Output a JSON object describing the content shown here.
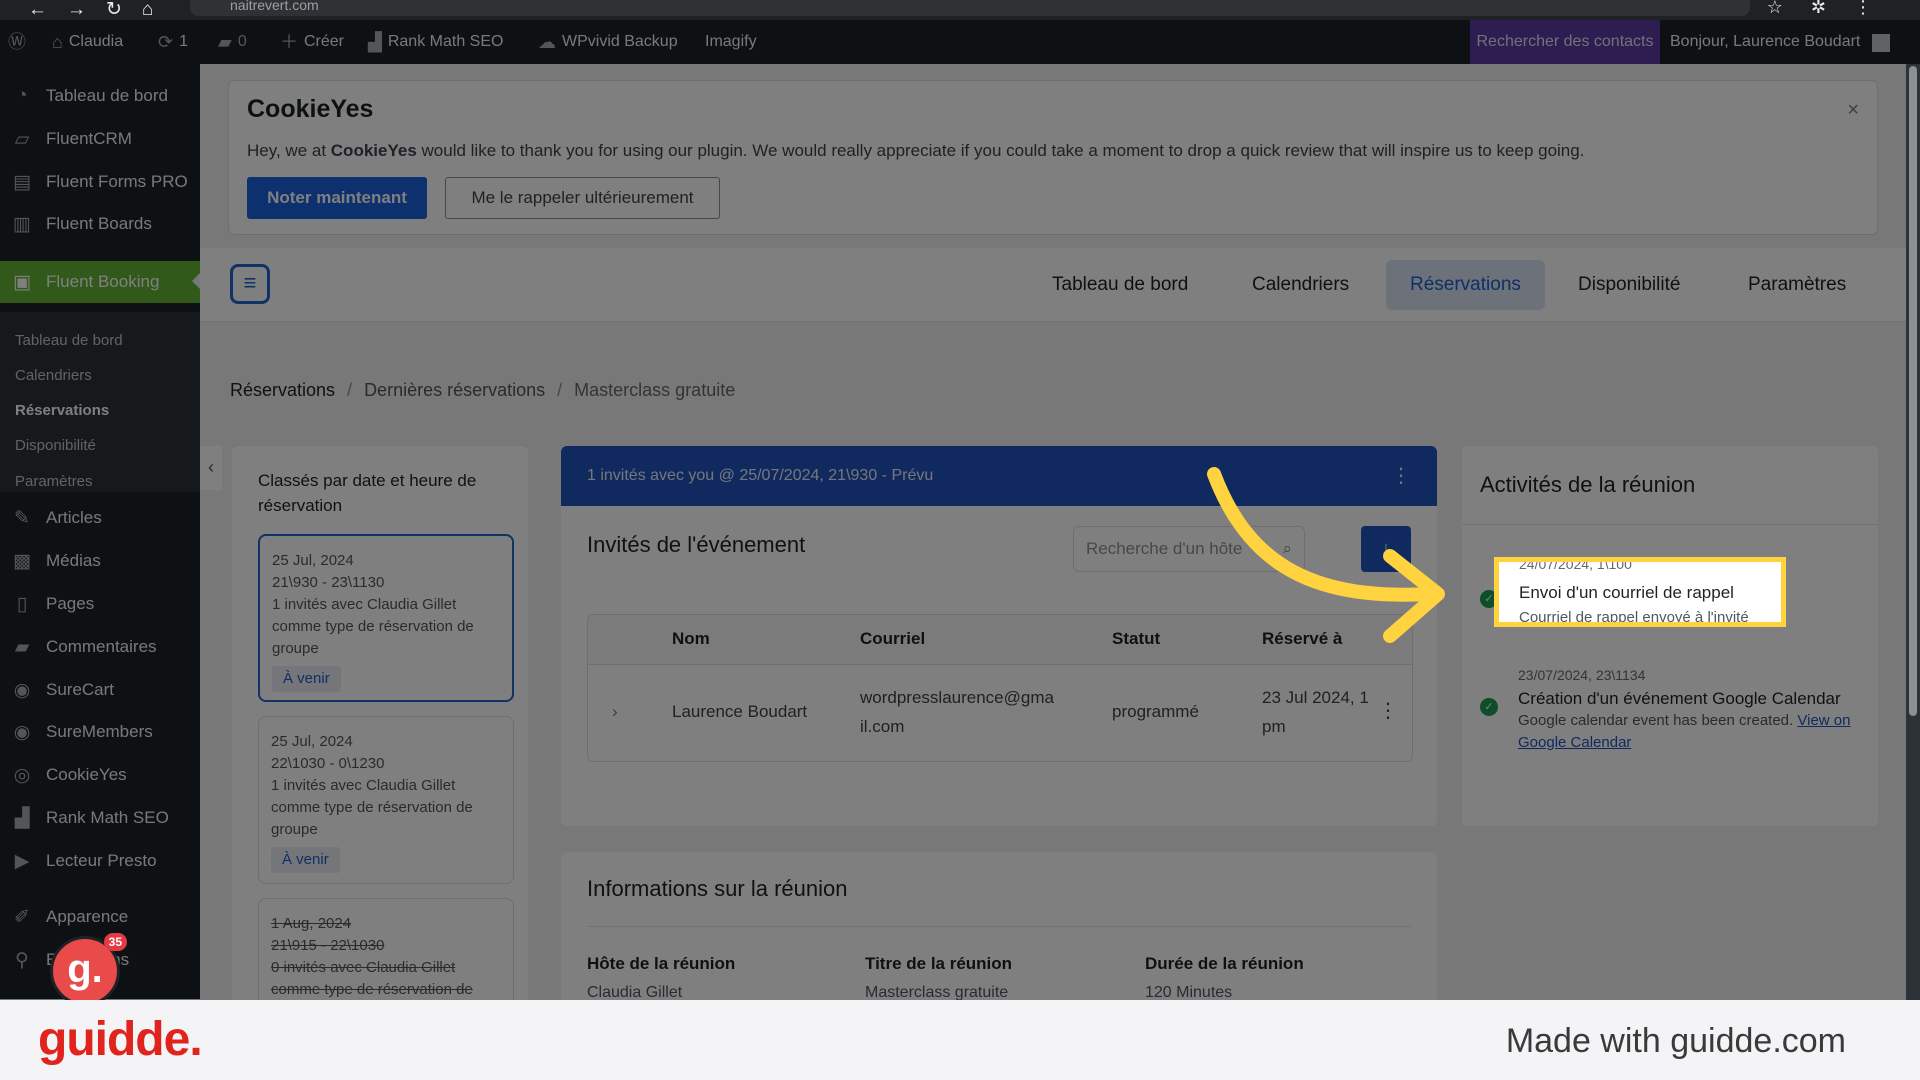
{
  "browser": {
    "url": "naitrevert.com"
  },
  "adminbar": {
    "site": "Claudia",
    "updates": "1",
    "comments": "0",
    "create": "Créer",
    "rankmath": "Rank Math SEO",
    "wpvivid": "WPvivid Backup",
    "imagify": "Imagify",
    "search": "Rechercher des contacts",
    "greeting": "Bonjour, Laurence Boudart"
  },
  "sidebar": {
    "items": [
      {
        "label": "Tableau de bord",
        "icon": "dashboard-icon"
      },
      {
        "label": "FluentCRM",
        "icon": "fluentcrm-icon"
      },
      {
        "label": "Fluent Forms PRO",
        "icon": "forms-icon"
      },
      {
        "label": "Fluent Boards",
        "icon": "boards-icon"
      },
      {
        "label": "Fluent Booking",
        "icon": "booking-icon"
      },
      {
        "label": "Articles",
        "icon": "pin-icon"
      },
      {
        "label": "Médias",
        "icon": "media-icon"
      },
      {
        "label": "Pages",
        "icon": "pages-icon"
      },
      {
        "label": "Commentaires",
        "icon": "comment-icon"
      },
      {
        "label": "SureCart",
        "icon": "surecart-icon"
      },
      {
        "label": "SureMembers",
        "icon": "suremembers-icon"
      },
      {
        "label": "CookieYes",
        "icon": "cookieyes-icon"
      },
      {
        "label": "Rank Math SEO",
        "icon": "rankmath-icon"
      },
      {
        "label": "Lecteur Presto",
        "icon": "presto-icon"
      },
      {
        "label": "Apparence",
        "icon": "appearance-icon"
      },
      {
        "label": "Extensions",
        "icon": "plugins-icon"
      }
    ],
    "submenu": [
      "Tableau de bord",
      "Calendriers",
      "Réservations",
      "Disponibilité",
      "Paramètres"
    ]
  },
  "cookie": {
    "logo": "CookieYes",
    "message_pre": "Hey, we at ",
    "message_brand": "CookieYes",
    "message_post": " would like to thank you for using our plugin. We would really appreciate if you could take a moment to drop a quick review that will inspire us to keep going.",
    "rate_button": "Noter maintenant",
    "remind_button": "Me le rappeler ultérieurement"
  },
  "appnav": {
    "tabs": [
      "Tableau de bord",
      "Calendriers",
      "Réservations",
      "Disponibilité",
      "Paramètres"
    ],
    "selected": "Réservations"
  },
  "breadcrumb": [
    "Réservations",
    "Dernières réservations",
    "Masterclass gratuite"
  ],
  "left": {
    "header": "Classés par date et heure de réservation",
    "bookings": [
      {
        "date": "25 Jul, 2024",
        "time": "21\\930 - 23\\1130",
        "desc": "1 invités avec Claudia Gillet comme type de réservation de groupe",
        "badge": "À venir"
      },
      {
        "date": "25 Jul, 2024",
        "time": "22\\1030 - 0\\1230",
        "desc": "1 invités avec Claudia Gillet comme type de réservation de groupe",
        "badge": "À venir"
      },
      {
        "date": "1 Aug, 2024",
        "time": "21\\915 - 22\\1030",
        "desc": "0 invités avec Claudia Gillet comme type de réservation de"
      }
    ]
  },
  "center": {
    "band": "1 invités avec you @ 25/07/2024, 21\\930 - Prévu",
    "title": "Invités de l'événement",
    "search_placeholder": "Recherche d'un hôte",
    "columns": [
      "Nom",
      "Courriel",
      "Statut",
      "Réservé à"
    ],
    "row": {
      "name": "Laurence Boudart",
      "email1": "wordpresslaurence@gma",
      "email2": "il.com",
      "status": "programmé",
      "booked1": "23 Jul 2024, 1",
      "booked2": "pm"
    }
  },
  "activities": {
    "title": "Activités de la réunion",
    "items": [
      {
        "date": "24/07/2024, 1\\100",
        "title": "Envoi d'un courriel de rappel",
        "sub": "Courriel de rappel envoyé à l'invité"
      },
      {
        "date": "23/07/2024, 23\\1134",
        "title": "Création d'un événement Google Calendar",
        "sub": "Google calendar event has been created. ",
        "link": "View on Google Calendar"
      }
    ]
  },
  "info": {
    "title": "Informations sur la réunion",
    "labels": [
      "Hôte de la réunion",
      "Titre de la réunion",
      "Durée de la réunion"
    ],
    "values": [
      "Claudia Gillet",
      "Masterclass gratuite",
      "120 Minutes"
    ]
  },
  "avatar_badge": {
    "letter": "g.",
    "count": "35"
  },
  "footer": {
    "brand": "guidde.",
    "made": "Made with guidde.com"
  },
  "colors": {
    "accent": "#2155c0",
    "highlight": "#ffd23f",
    "booking_green": "#61b234",
    "brand_red": "#e0241d"
  }
}
